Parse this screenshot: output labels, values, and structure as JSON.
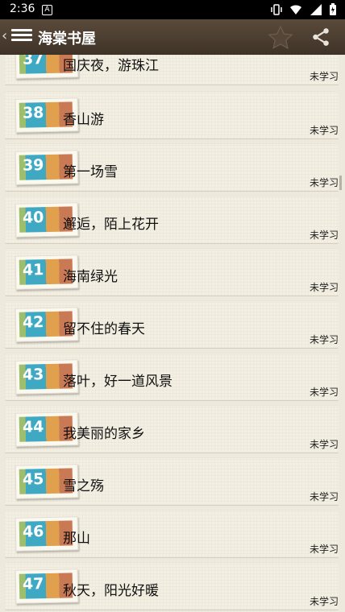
{
  "status_bar": {
    "time": "2:36",
    "notification_badge": "A"
  },
  "app_bar": {
    "back_glyph": "‹",
    "title": "海棠书屋"
  },
  "lessons": [
    {
      "num": "37",
      "title": "国庆夜，游珠江",
      "status": "未学习"
    },
    {
      "num": "38",
      "title": "香山游",
      "status": "未学习"
    },
    {
      "num": "39",
      "title": "第一场雪",
      "status": "未学习"
    },
    {
      "num": "40",
      "title": "邂逅，陌上花开",
      "status": "未学习"
    },
    {
      "num": "41",
      "title": "海南绿光",
      "status": "未学习"
    },
    {
      "num": "42",
      "title": "留不住的春天",
      "status": "未学习"
    },
    {
      "num": "43",
      "title": "落叶，好一道风景",
      "status": "未学习"
    },
    {
      "num": "44",
      "title": "我美丽的家乡",
      "status": "未学习"
    },
    {
      "num": "45",
      "title": "雪之殇",
      "status": "未学习"
    },
    {
      "num": "46",
      "title": "那山",
      "status": "未学习"
    },
    {
      "num": "47",
      "title": "秋天，阳光好暖",
      "status": "未学习"
    }
  ]
}
